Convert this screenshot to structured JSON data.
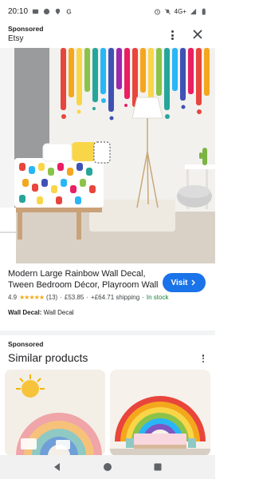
{
  "status_bar": {
    "time": "20:10",
    "network": "4G+"
  },
  "ad": {
    "sponsored_label": "Sponsored",
    "advertiser": "Etsy"
  },
  "product": {
    "title": "Modern Large Rainbow Wall Decal, Tween Bedroom Décor, Playroom Wall Murals,...",
    "rating": "4.9",
    "stars": "★★★★★",
    "review_count": "(13)",
    "separator": "·",
    "price": "£53.85",
    "shipping": "+£64.71 shipping",
    "stock": "In stock",
    "visit_label": "Visit",
    "attribute_name": "Wall Decal:",
    "attribute_value": "Wall Decal"
  },
  "similar": {
    "sponsored_label": "Sponsored",
    "title": "Similar products"
  },
  "icons": {
    "visit": "arrow-right-icon",
    "more": "more-vert-icon",
    "close": "close-icon"
  },
  "colors": {
    "accent": "#1a73e8",
    "in_stock": "#188038",
    "stars": "#f4a915"
  }
}
